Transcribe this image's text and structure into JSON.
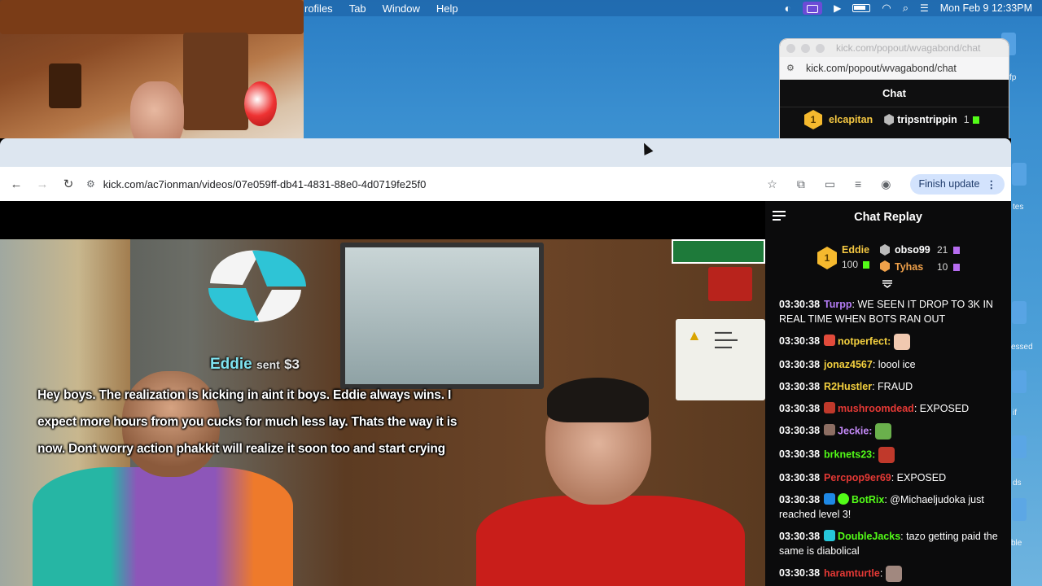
{
  "menubar": {
    "items": [
      "rofiles",
      "Tab",
      "Window",
      "Help"
    ],
    "clock": "Mon Feb 9  12:33PM"
  },
  "desktop_labels": [
    "fp",
    "tes",
    "essed",
    "if",
    "ds",
    "ble"
  ],
  "popout": {
    "title": "kick.com/popout/wvagabond/chat",
    "url": "kick.com/popout/wvagabond/chat",
    "chat_header": "Chat",
    "leader1_rank": "1",
    "leader1_name": "elcapitan",
    "leader2_name": "tripsntrippin",
    "leader2_count": "1"
  },
  "browser": {
    "url": "kick.com/ac7ionman/videos/07e059ff-db41-4831-88e0-4d0719fe25f0",
    "finish_update": "Finish update"
  },
  "donation": {
    "name": "Eddie",
    "sent": "sent",
    "amount": "$3",
    "lines": [
      "Hey boys. The realization is kicking in aint it boys. Eddie always wins. I",
      "expect more hours from you cucks for much less lay. Thats the way it is",
      "now. Dont worry action phakkit will realize it soon too and start crying"
    ]
  },
  "chat": {
    "header": "Chat Replay",
    "leaderboard": {
      "first": {
        "rank": "1",
        "name": "Eddie",
        "count": "100"
      },
      "second": {
        "name": "obso99",
        "count": "21"
      },
      "third": {
        "name": "Tyhas",
        "count": "10"
      }
    },
    "messages": [
      {
        "ts": "03:30:38",
        "user": "Turpp",
        "color": "#b47cf5",
        "text": ": WE SEEN IT DROP TO 3K IN REAL TIME WHEN BOTS RAN OUT"
      },
      {
        "ts": "03:30:38",
        "user": "notperfect:",
        "color": "#f4d03f",
        "text": ""
      },
      {
        "ts": "03:30:38",
        "user": "jonaz4567",
        "color": "#f4d03f",
        "text": ": loool ice"
      },
      {
        "ts": "03:30:38",
        "user": "R2Hustler",
        "color": "#f4d03f",
        "text": ": FRAUD"
      },
      {
        "ts": "03:30:38",
        "user": "mushroomdead",
        "color": "#e53935",
        "text": ": EXPOSED"
      },
      {
        "ts": "03:30:38",
        "user": "Jeckie:",
        "color": "#c58af9",
        "text": ""
      },
      {
        "ts": "03:30:38",
        "user": "brknets23:",
        "color": "#53fc18",
        "text": ""
      },
      {
        "ts": "03:30:38",
        "user": "Percpop9er69",
        "color": "#e53935",
        "text": ": EXPOSED"
      },
      {
        "ts": "03:30:38",
        "user": "BotRix",
        "color": "#53fc18",
        "text": ": @Michaeljudoka just reached level 3!"
      },
      {
        "ts": "03:30:38",
        "user": "DoubleJacks",
        "color": "#53fc18",
        "text": ": tazo getting paid the same is diabolical"
      },
      {
        "ts": "03:30:38",
        "user": "haramturtle",
        "color": "#e53935",
        "text": ":"
      }
    ]
  }
}
